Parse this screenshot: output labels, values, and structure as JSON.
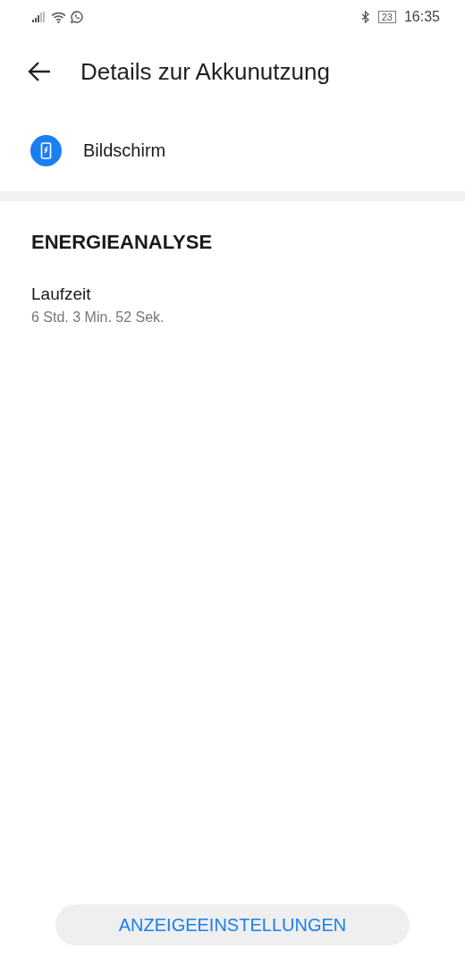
{
  "status_bar": {
    "battery": "23",
    "time": "16:35"
  },
  "header": {
    "title": "Details zur Akkunutzung"
  },
  "app_item": {
    "label": "Bildschirm"
  },
  "section": {
    "title": "ENERGIEANALYSE",
    "items": [
      {
        "label": "Laufzeit",
        "value": "6 Std. 3 Min. 52 Sek."
      }
    ]
  },
  "footer_button": {
    "label": "ANZEIGEEINSTELLUNGEN"
  }
}
